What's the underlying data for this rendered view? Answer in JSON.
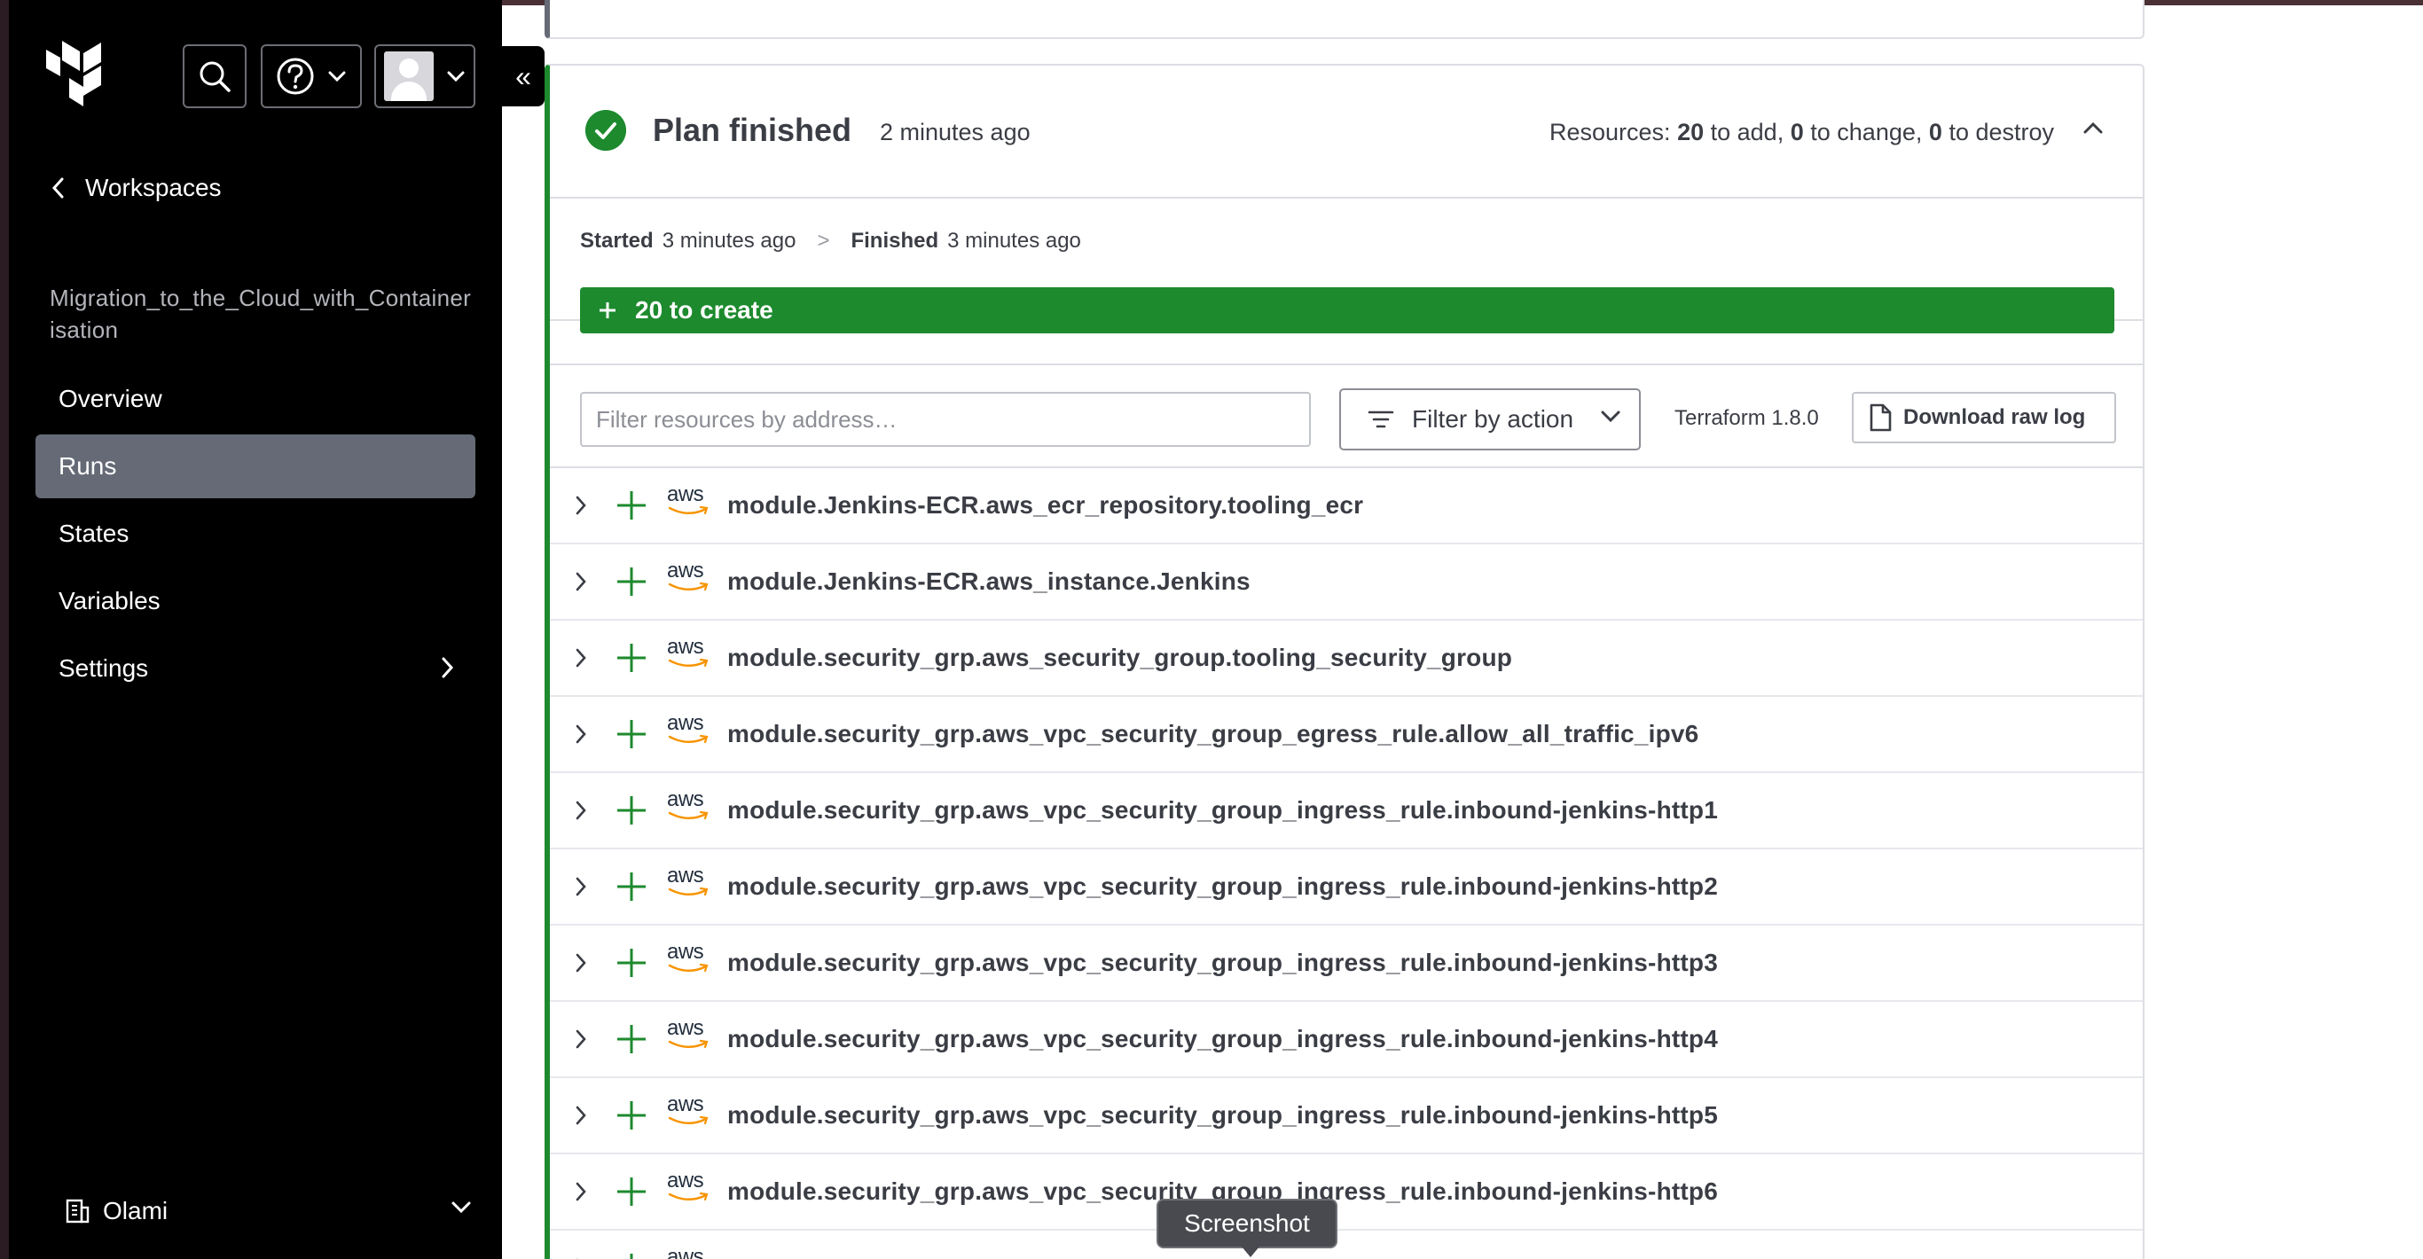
{
  "header": {
    "search_icon": "search-icon",
    "help_icon": "help-icon",
    "user_icon": "avatar",
    "collapse_label": "«"
  },
  "sidebar": {
    "back_label": "Workspaces",
    "workspace_name": "Migration_to_the_Cloud_with_Containerisation",
    "items": [
      {
        "label": "Overview",
        "active": false
      },
      {
        "label": "Runs",
        "active": true
      },
      {
        "label": "States",
        "active": false
      },
      {
        "label": "Variables",
        "active": false
      },
      {
        "label": "Settings",
        "active": false
      }
    ],
    "org_name": "Olami"
  },
  "plan": {
    "title": "Plan finished",
    "time_ago": "2 minutes ago",
    "resources_prefix": "Resources:",
    "add_count": "20",
    "add_label": "to add,",
    "change_count": "0",
    "change_label": "to change,",
    "destroy_count": "0",
    "destroy_label": "to destroy",
    "status_color": "#1d8a2e"
  },
  "timeline": {
    "started_label": "Started",
    "started_value": "3 minutes ago",
    "separator": ">",
    "finished_label": "Finished",
    "finished_value": "3 minutes ago"
  },
  "create_bar": {
    "label": "20 to create"
  },
  "filters": {
    "placeholder": "Filter resources by address…",
    "action_label": "Filter by action",
    "terraform_version": "Terraform 1.8.0",
    "download_label": "Download raw log"
  },
  "resources": [
    {
      "provider": "aws",
      "address": "module.Jenkins-ECR.aws_ecr_repository.tooling_ecr"
    },
    {
      "provider": "aws",
      "address": "module.Jenkins-ECR.aws_instance.Jenkins"
    },
    {
      "provider": "aws",
      "address": "module.security_grp.aws_security_group.tooling_security_group"
    },
    {
      "provider": "aws",
      "address": "module.security_grp.aws_vpc_security_group_egress_rule.allow_all_traffic_ipv6"
    },
    {
      "provider": "aws",
      "address": "module.security_grp.aws_vpc_security_group_ingress_rule.inbound-jenkins-http1"
    },
    {
      "provider": "aws",
      "address": "module.security_grp.aws_vpc_security_group_ingress_rule.inbound-jenkins-http2"
    },
    {
      "provider": "aws",
      "address": "module.security_grp.aws_vpc_security_group_ingress_rule.inbound-jenkins-http3"
    },
    {
      "provider": "aws",
      "address": "module.security_grp.aws_vpc_security_group_ingress_rule.inbound-jenkins-http4"
    },
    {
      "provider": "aws",
      "address": "module.security_grp.aws_vpc_security_group_ingress_rule.inbound-jenkins-http5"
    },
    {
      "provider": "aws",
      "address": "module.security_grp.aws_vpc_security_group_ingress_rule.inbound-jenkins-http6"
    },
    {
      "provider": "aws",
      "address": ""
    }
  ],
  "tooltip": {
    "label": "Screenshot"
  }
}
